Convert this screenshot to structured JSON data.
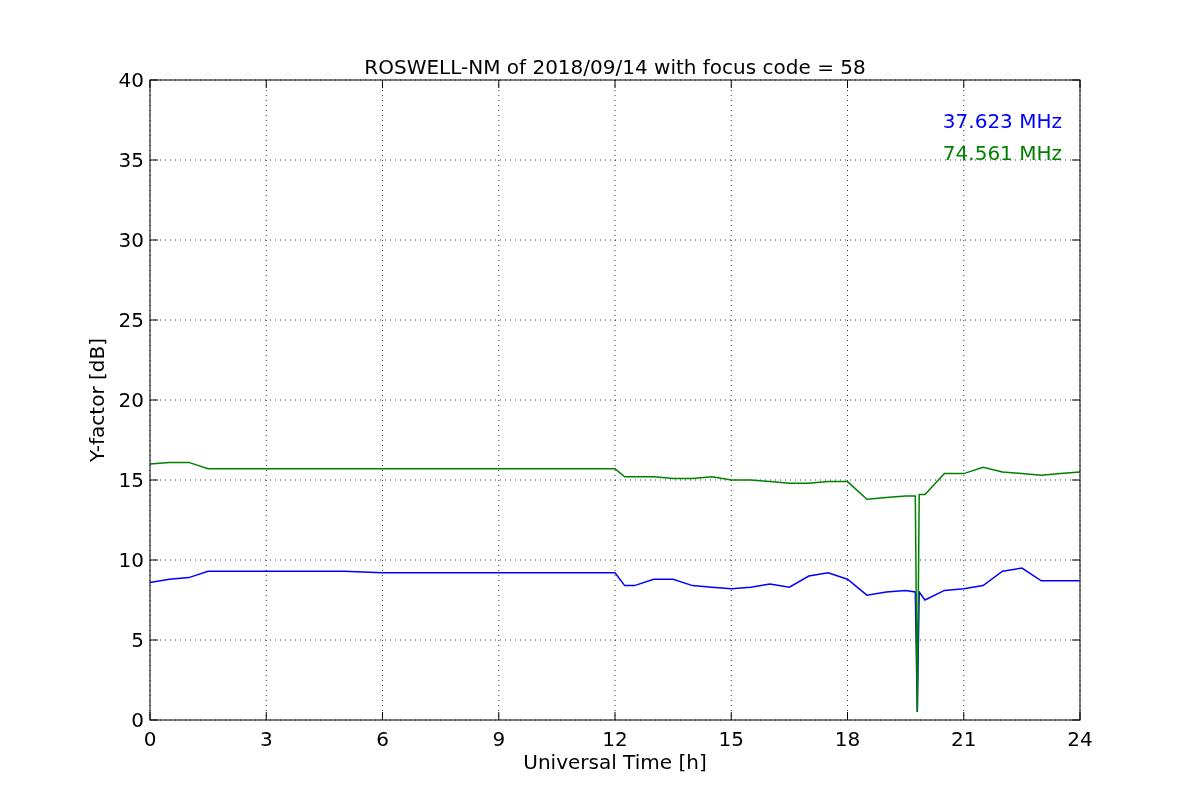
{
  "chart_data": {
    "type": "line",
    "title": "ROSWELL-NM of 2018/09/14 with focus code = 58",
    "xlabel": "Universal Time [h]",
    "ylabel": "Y-factor [dB]",
    "x": [
      0,
      0.5,
      1,
      1.5,
      2,
      3,
      4,
      5,
      6,
      7,
      8,
      9,
      10,
      11,
      12,
      12.25,
      12.5,
      13,
      13.5,
      14,
      14.5,
      15,
      15.5,
      16,
      16.5,
      17,
      17.5,
      18,
      18.5,
      19,
      19.5,
      19.75,
      19.8,
      19.85,
      20,
      20.5,
      21,
      21.5,
      22,
      22.5,
      23,
      23.5,
      24
    ],
    "series": [
      {
        "name": "37.623 MHz",
        "color": "#0000ff",
        "values": [
          8.6,
          8.8,
          8.9,
          9.3,
          9.3,
          9.3,
          9.3,
          9.3,
          9.2,
          9.2,
          9.2,
          9.2,
          9.2,
          9.2,
          9.2,
          8.4,
          8.4,
          8.8,
          8.8,
          8.4,
          8.3,
          8.2,
          8.3,
          8.5,
          8.3,
          9.0,
          9.2,
          8.8,
          7.8,
          8.0,
          8.1,
          8.0,
          0.5,
          8.0,
          7.5,
          8.1,
          8.2,
          8.4,
          9.3,
          9.5,
          8.7,
          8.7,
          8.7
        ]
      },
      {
        "name": "74.561 MHz",
        "color": "#008000",
        "values": [
          16.0,
          16.1,
          16.1,
          15.7,
          15.7,
          15.7,
          15.7,
          15.7,
          15.7,
          15.7,
          15.7,
          15.7,
          15.7,
          15.7,
          15.7,
          15.2,
          15.2,
          15.2,
          15.1,
          15.1,
          15.2,
          15.0,
          15.0,
          14.9,
          14.8,
          14.8,
          14.9,
          14.9,
          13.8,
          13.9,
          14.0,
          14.0,
          0.5,
          14.1,
          14.1,
          15.4,
          15.4,
          15.8,
          15.5,
          15.4,
          15.3,
          15.4,
          15.5
        ]
      }
    ],
    "grid": true,
    "xlim": [
      0,
      24
    ],
    "ylim": [
      0,
      40
    ],
    "xticks": [
      0,
      3,
      6,
      9,
      12,
      15,
      18,
      21,
      24
    ],
    "yticks": [
      0,
      5,
      10,
      15,
      20,
      25,
      30,
      35,
      40
    ]
  }
}
